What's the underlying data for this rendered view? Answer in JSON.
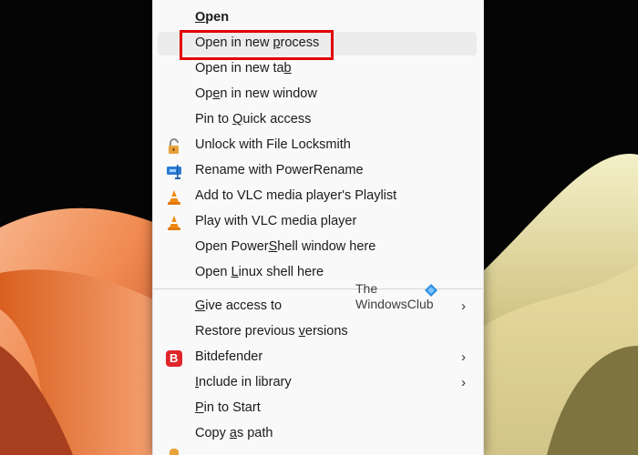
{
  "menu": {
    "items": [
      {
        "pre": "",
        "mn": "O",
        "post": "pen",
        "bold": true
      },
      {
        "pre": "Open in new ",
        "mn": "p",
        "post": "rocess"
      },
      {
        "pre": "Open in new ta",
        "mn": "b",
        "post": ""
      },
      {
        "pre": "Op",
        "mn": "e",
        "post": "n in new window"
      },
      {
        "pre": "Pin to ",
        "mn": "Q",
        "post": "uick access"
      },
      {
        "pre": "Unlock with File Locksmith",
        "mn": "",
        "post": "",
        "icon": "unlock-icon"
      },
      {
        "pre": "Rename with PowerRename",
        "mn": "",
        "post": "",
        "icon": "powerrename-icon"
      },
      {
        "pre": "Add to VLC media player's Playlist",
        "mn": "",
        "post": "",
        "icon": "vlc-cone-icon"
      },
      {
        "pre": "Play with VLC media player",
        "mn": "",
        "post": "",
        "icon": "vlc-cone-icon"
      },
      {
        "pre": "Open Power",
        "mn": "S",
        "post": "hell window here"
      },
      {
        "pre": "Open ",
        "mn": "L",
        "post": "inux shell here"
      },
      {
        "pre": "",
        "mn": "G",
        "post": "ive access to",
        "chevron": true
      },
      {
        "pre": "Restore previous ",
        "mn": "v",
        "post": "ersions"
      },
      {
        "pre": "Bitdefender",
        "mn": "",
        "post": "",
        "icon": "bitdefender-icon",
        "chevron": true
      },
      {
        "pre": "",
        "mn": "I",
        "post": "nclude in library",
        "chevron": true
      },
      {
        "pre": "",
        "mn": "P",
        "post": "in to Start"
      },
      {
        "pre": "Copy ",
        "mn": "a",
        "post": "s path"
      }
    ],
    "chevron_glyph": "›",
    "bitdefender_glyph": "B"
  },
  "watermark": {
    "line1": "The",
    "line2": "WindowsClub"
  },
  "colors": {
    "highlight": "#e10000",
    "menu_bg": "#f9f9f9",
    "hover_bg": "#ececec"
  }
}
